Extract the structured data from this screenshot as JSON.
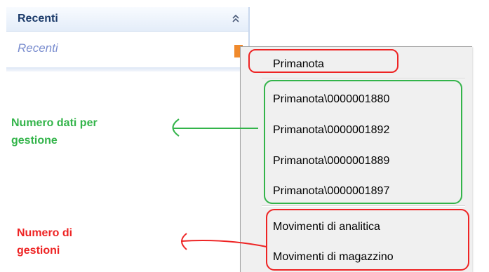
{
  "panel": {
    "title": "Recenti",
    "subtitle": "Recenti",
    "collapse_icon": "double-chevron-up-icon"
  },
  "menu": {
    "items": [
      "Primanota",
      "Primanota\\0000001880",
      "Primanota\\0000001892",
      "Primanota\\0000001889",
      "Primanota\\0000001897",
      "Movimenti di analitica",
      "Movimenti di magazzino"
    ]
  },
  "annotations": {
    "green_label_line1": "Numero dati per",
    "green_label_line2": "gestione",
    "red_label_line1": "Numero di",
    "red_label_line2": "gestioni",
    "colors": {
      "green": "#33b44a",
      "red": "#ee2424",
      "menu_background": "#f0f0f0",
      "accent_orange": "#f08a2c",
      "header_text": "#1c3b6a",
      "subtitle_text": "#7a8dcf"
    }
  }
}
